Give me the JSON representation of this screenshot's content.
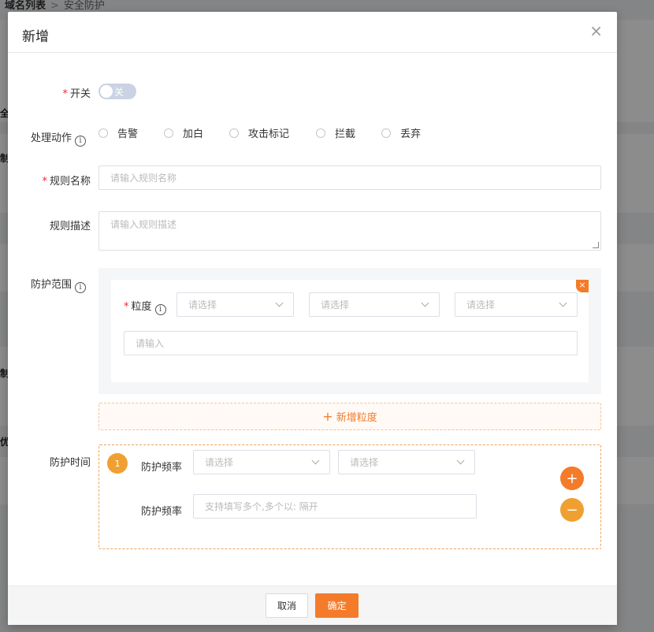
{
  "background": {
    "breadcrumb_root": "域名列表",
    "breadcrumb_sep": ">",
    "breadcrumb_current": "安全防护",
    "fragments": [
      "全",
      "制",
      "制",
      "优"
    ]
  },
  "modal": {
    "title": "新增",
    "close": "×",
    "switch": {
      "label": "开关",
      "state_text": "关",
      "on": false
    },
    "action": {
      "label": "处理动作",
      "options": [
        "告警",
        "加白",
        "攻击标记",
        "拦截",
        "丢弃"
      ]
    },
    "rule_name": {
      "label": "规则名称",
      "placeholder": "请输入规则名称"
    },
    "rule_desc": {
      "label": "规则描述",
      "placeholder": "请输入规则描述"
    },
    "range": {
      "label": "防护范围",
      "granularity_label": "粒度",
      "select_placeholder": "请选择",
      "input_placeholder": "请输入",
      "add_label": "新增粒度"
    },
    "time": {
      "label": "防护时间",
      "index": "1",
      "freq_label": "防护频率",
      "select_placeholder": "请选择",
      "freq_input_placeholder": "支持填写多个,多个以: 隔开"
    },
    "footer": {
      "cancel": "取消",
      "ok": "确定"
    },
    "colors": {
      "accent": "#f47b2a",
      "badge": "#f0a030",
      "required": "#f5222d"
    }
  }
}
